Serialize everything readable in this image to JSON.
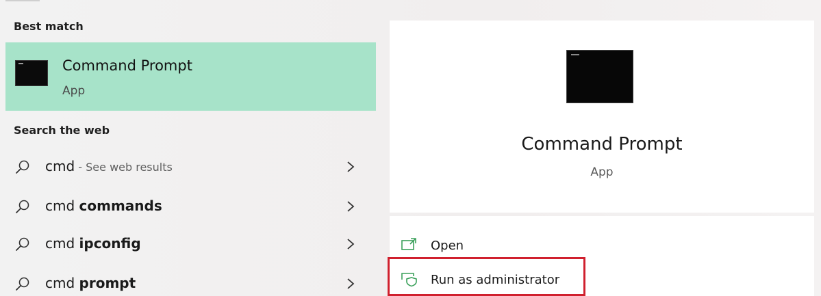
{
  "left": {
    "best_match_header": "Best match",
    "best_match": {
      "title": "Command Prompt",
      "subtitle": "App",
      "icon": "terminal-icon"
    },
    "web_header": "Search the web",
    "web_results": [
      {
        "prefix": "cmd",
        "bold": "",
        "hint": " - See web results"
      },
      {
        "prefix": "cmd ",
        "bold": "commands",
        "hint": ""
      },
      {
        "prefix": "cmd ",
        "bold": "ipconfig",
        "hint": ""
      },
      {
        "prefix": "cmd ",
        "bold": "prompt",
        "hint": ""
      }
    ]
  },
  "preview": {
    "title": "Command Prompt",
    "subtitle": "App",
    "icon": "terminal-icon"
  },
  "actions": [
    {
      "label": "Open",
      "icon": "open-window-icon"
    },
    {
      "label": "Run as administrator",
      "icon": "shield-run-icon"
    }
  ],
  "colors": {
    "best_match_bg": "#a7e3c9",
    "accent_green": "#3aa05a",
    "highlight_red": "#d0202e"
  }
}
